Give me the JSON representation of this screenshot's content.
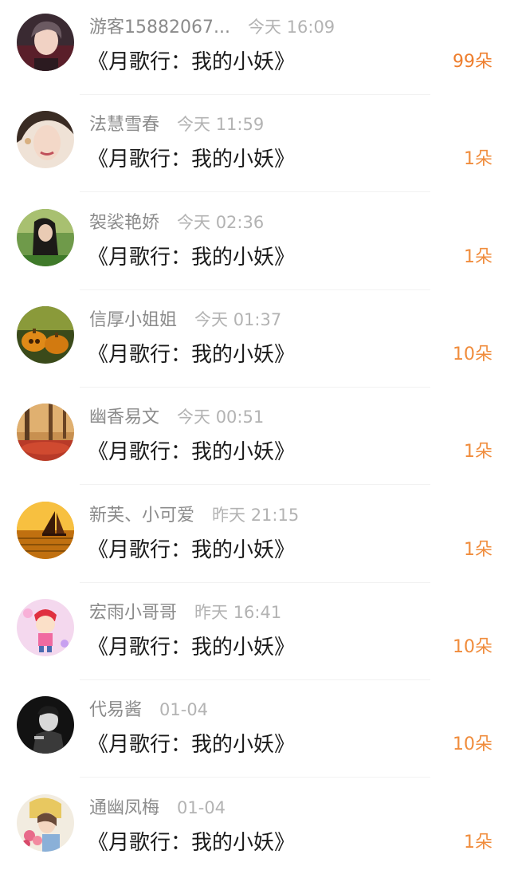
{
  "colors": {
    "username": "#8b8b8b",
    "time": "#b3b3b3",
    "title": "#1a1a1a",
    "count": "#f08c3c",
    "count_highlight": "#ee7e2d",
    "divider": "#f2f2f2"
  },
  "gifts": [
    {
      "user": "游客15882067...",
      "time": "今天 16:09",
      "title": "《月歌行：我的小妖》",
      "count": "99朵",
      "avatar": "avatar-young-man-icon"
    },
    {
      "user": "法慧雪春",
      "time": "今天 11:59",
      "title": "《月歌行：我的小妖》",
      "count": "1朵",
      "avatar": "avatar-woman-portrait-icon"
    },
    {
      "user": "袈裟艳娇",
      "time": "今天 02:36",
      "title": "《月歌行：我的小妖》",
      "count": "1朵",
      "avatar": "avatar-girl-in-garden-icon"
    },
    {
      "user": "信厚小姐姐",
      "time": "今天 01:37",
      "title": "《月歌行：我的小妖》",
      "count": "10朵",
      "avatar": "avatar-pumpkins-icon"
    },
    {
      "user": "幽香易文",
      "time": "今天 00:51",
      "title": "《月歌行：我的小妖》",
      "count": "1朵",
      "avatar": "avatar-autumn-forest-icon"
    },
    {
      "user": "新芙、小可爱",
      "time": "昨天 21:15",
      "title": "《月歌行：我的小妖》",
      "count": "1朵",
      "avatar": "avatar-sailboat-sunset-icon"
    },
    {
      "user": "宏雨小哥哥",
      "time": "昨天 16:41",
      "title": "《月歌行：我的小妖》",
      "count": "10朵",
      "avatar": "avatar-cartoon-boy-icon"
    },
    {
      "user": "代易酱",
      "time": "01-04",
      "title": "《月歌行：我的小妖》",
      "count": "10朵",
      "avatar": "avatar-man-bw-icon"
    },
    {
      "user": "通幽凤梅",
      "time": "01-04",
      "title": "《月歌行：我的小妖》",
      "count": "1朵",
      "avatar": "avatar-girl-with-flowers-icon"
    }
  ]
}
